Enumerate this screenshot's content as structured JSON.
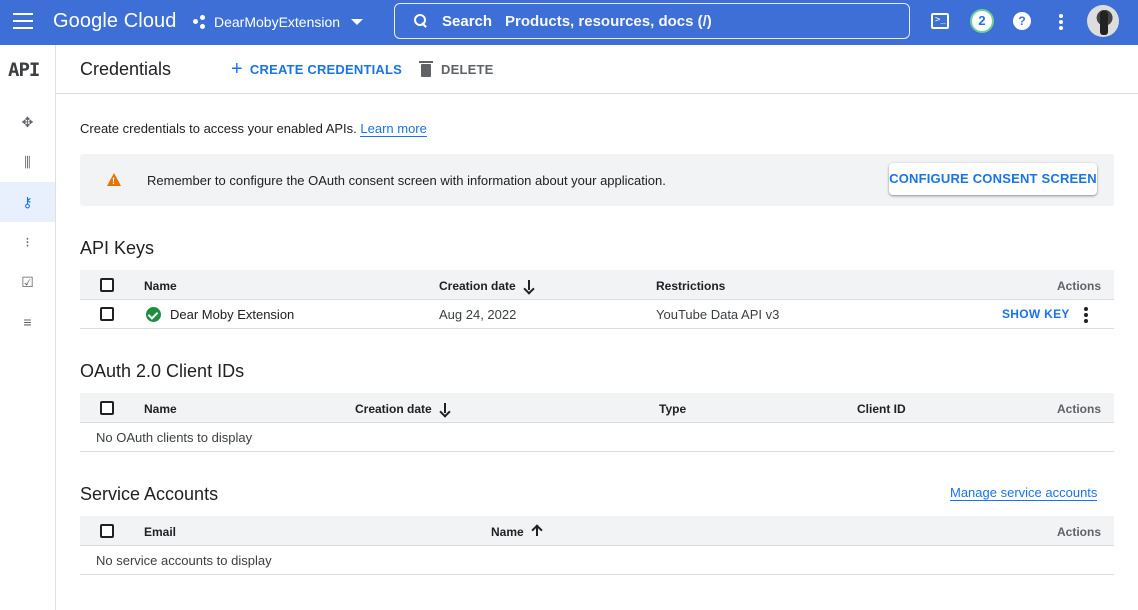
{
  "topbar": {
    "brand": "Google Cloud",
    "project": "DearMobyExtension",
    "search_label": "Search",
    "search_placeholder": "Products, resources, docs (/)",
    "notification_count": "2",
    "terminal_glyph": ">_",
    "help_glyph": "?"
  },
  "rail": {
    "logo": "API",
    "items": [
      {
        "icon": "diamond-icon",
        "glyph": "✥"
      },
      {
        "icon": "library-icon",
        "glyph": "⫼"
      },
      {
        "icon": "key-icon",
        "glyph": "⚷"
      },
      {
        "icon": "consent-icon",
        "glyph": "⁝"
      },
      {
        "icon": "checkbox-icon",
        "glyph": "☑"
      },
      {
        "icon": "settings-list-icon",
        "glyph": "≡"
      }
    ]
  },
  "header": {
    "title": "Credentials",
    "create_label": "CREATE CREDENTIALS",
    "delete_label": "DELETE"
  },
  "intro": {
    "text": "Create credentials to access your enabled APIs.",
    "link": "Learn more"
  },
  "banner": {
    "text": "Remember to configure the OAuth consent screen with information about your application.",
    "button": "CONFIGURE CONSENT SCREEN"
  },
  "api_keys": {
    "title": "API Keys",
    "columns": [
      "Name",
      "Creation date",
      "Restrictions",
      "Actions"
    ],
    "rows": [
      {
        "name": "Dear Moby Extension",
        "date": "Aug 24, 2022",
        "restrictions": "YouTube Data API v3",
        "action": "SHOW KEY"
      }
    ]
  },
  "oauth": {
    "title": "OAuth 2.0 Client IDs",
    "columns": [
      "Name",
      "Creation date",
      "Type",
      "Client ID",
      "Actions"
    ],
    "empty": "No OAuth clients to display"
  },
  "service_accounts": {
    "title": "Service Accounts",
    "manage_link": "Manage service accounts",
    "columns": [
      "Email",
      "Name",
      "Actions"
    ],
    "empty": "No service accounts to display"
  },
  "colors": {
    "topbar": "#3d6fd6",
    "accent": "#1a73e8",
    "warning": "#e37400",
    "success": "#1e8e3e"
  }
}
